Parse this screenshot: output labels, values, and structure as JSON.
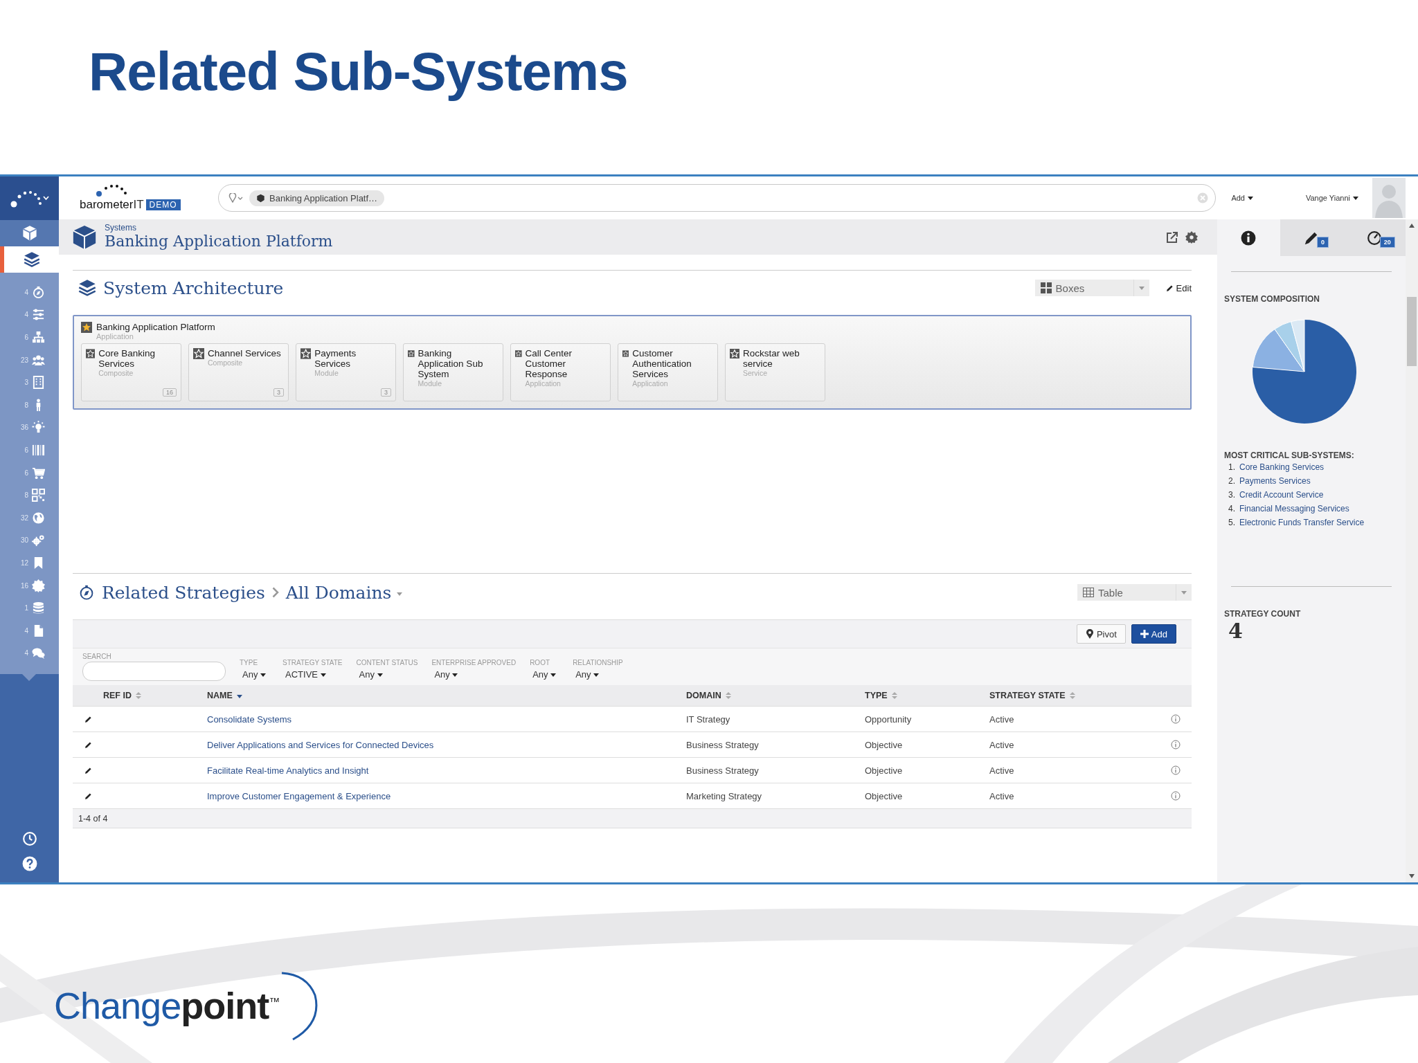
{
  "slide": {
    "title": "Related Sub-Systems",
    "logo": "Change**point**$^{™}$"
  },
  "header": {
    "brand": "barometer",
    "brand_suffix": "IT",
    "badge": "DEMO",
    "search_chip": "Banking Application Platf…",
    "add_menu": "Add",
    "user": "Vange Yianni"
  },
  "sidebar": {
    "nav": [
      {
        "selected": false
      },
      {
        "selected": true
      }
    ],
    "items": [
      {
        "count": "4"
      },
      {
        "count": "4"
      },
      {
        "count": "6"
      },
      {
        "count": "23"
      },
      {
        "count": "3"
      },
      {
        "count": "8"
      },
      {
        "count": "36"
      },
      {
        "count": "6"
      },
      {
        "count": "6"
      },
      {
        "count": "8"
      },
      {
        "count": "32"
      },
      {
        "count": "30"
      },
      {
        "count": "12"
      },
      {
        "count": "16"
      },
      {
        "count": "1"
      },
      {
        "count": "4"
      },
      {
        "count": "4"
      }
    ]
  },
  "page": {
    "breadcrumb": "Systems",
    "title": "Banking Application Platform"
  },
  "architecture": {
    "title": "System Architecture",
    "view": "Boxes",
    "edit": "Edit",
    "root": {
      "name": "Banking Application Platform",
      "type": "Application"
    },
    "children": [
      {
        "name": "Core Banking Services",
        "type": "Composite",
        "count": "16"
      },
      {
        "name": "Channel Services",
        "type": "Composite",
        "count": "3"
      },
      {
        "name": "Payments Services",
        "type": "Module",
        "count": "3"
      },
      {
        "name": "Banking Application Sub System",
        "type": "Module"
      },
      {
        "name": "Call Center Customer Response",
        "type": "Application"
      },
      {
        "name": "Customer Authentication Services",
        "type": "Application"
      },
      {
        "name": "Rockstar web service",
        "type": "Service"
      }
    ]
  },
  "strategies": {
    "title": "Related Strategies",
    "scope": "All Domains",
    "view": "Table",
    "pivot": "Pivot",
    "add": "Add",
    "search_label": "SEARCH",
    "filters": [
      {
        "label": "TYPE",
        "value": "Any"
      },
      {
        "label": "STRATEGY STATE",
        "value": "ACTIVE"
      },
      {
        "label": "CONTENT STATUS",
        "value": "Any"
      },
      {
        "label": "ENTERPRISE APPROVED",
        "value": "Any"
      },
      {
        "label": "ROOT",
        "value": "Any"
      },
      {
        "label": "RELATIONSHIP",
        "value": "Any"
      }
    ],
    "columns": [
      {
        "label": "REF ID",
        "sorted": false
      },
      {
        "label": "NAME",
        "sorted": true
      },
      {
        "label": "DOMAIN",
        "sorted": false
      },
      {
        "label": "TYPE",
        "sorted": false
      },
      {
        "label": "STRATEGY STATE",
        "sorted": false
      }
    ],
    "rows": [
      {
        "name": "Consolidate Systems",
        "domain": "IT Strategy",
        "type": "Opportunity",
        "state": "Active"
      },
      {
        "name": "Deliver Applications and Services for Connected Devices",
        "domain": "Business Strategy",
        "type": "Objective",
        "state": "Active"
      },
      {
        "name": "Facilitate Real-time Analytics and Insight",
        "domain": "Business Strategy",
        "type": "Objective",
        "state": "Active"
      },
      {
        "name": "Improve Customer Engagement & Experience",
        "domain": "Marketing Strategy",
        "type": "Objective",
        "state": "Active"
      }
    ],
    "pager": "1-4 of 4"
  },
  "info_panel": {
    "tabs": [
      {
        "selected": true
      },
      {
        "selected": false,
        "badge": "0"
      },
      {
        "selected": false,
        "badge": "20"
      }
    ],
    "composition_title": "SYSTEM COMPOSITION",
    "critical_title": "MOST CRITICAL SUB-SYSTEMS:",
    "critical": [
      {
        "rank": "1.",
        "name": "Core Banking Services"
      },
      {
        "rank": "2.",
        "name": "Payments Services"
      },
      {
        "rank": "3.",
        "name": "Credit Account Service"
      },
      {
        "rank": "4.",
        "name": "Financial Messaging Services"
      },
      {
        "rank": "5.",
        "name": "Electronic Funds Transfer Service"
      }
    ],
    "count_title": "STRATEGY COUNT",
    "count": "4"
  }
}
